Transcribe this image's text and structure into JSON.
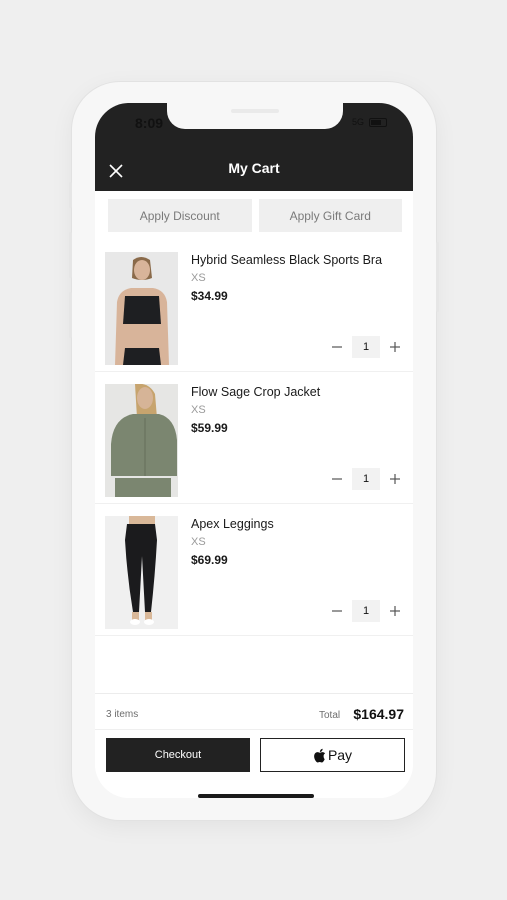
{
  "status_bar": {
    "time": "8:09",
    "signal": "5G"
  },
  "header": {
    "title": "My Cart"
  },
  "promo": {
    "discount_label": "Apply Discount",
    "gift_card_label": "Apply Gift Card"
  },
  "cart": {
    "items": [
      {
        "name": "Hybrid Seamless Black Sports Bra",
        "size": "XS",
        "price": "$34.99",
        "quantity": "1"
      },
      {
        "name": "Flow Sage Crop Jacket",
        "size": "XS",
        "price": "$59.99",
        "quantity": "1"
      },
      {
        "name": "Apex Leggings",
        "size": "XS",
        "price": "$69.99",
        "quantity": "1"
      }
    ]
  },
  "footer": {
    "item_count": "3 items",
    "total_label": "Total",
    "total_value": "$164.97",
    "checkout_label": "Checkout",
    "apple_pay_label": "Pay"
  },
  "icons": [
    "close-icon",
    "minus-icon",
    "plus-icon",
    "apple-logo-icon",
    "battery-icon"
  ],
  "colors": {
    "dark": "#222222",
    "background": "#efefef",
    "button_gray": "#efefef"
  }
}
